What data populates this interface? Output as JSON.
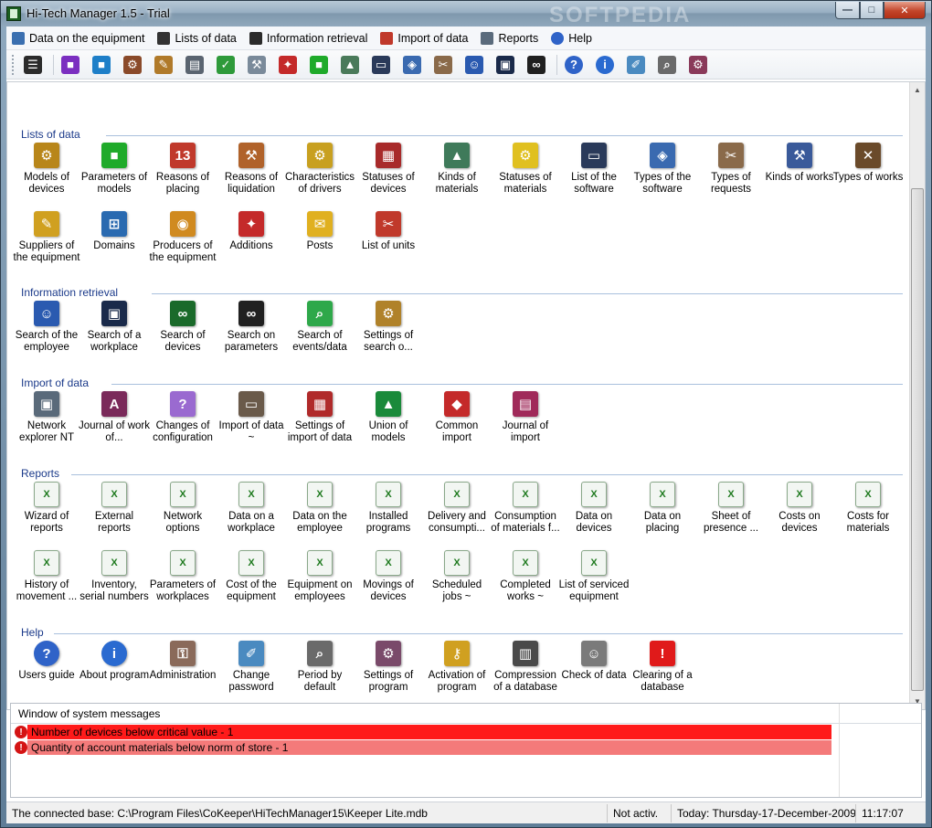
{
  "window": {
    "title": "Hi-Tech Manager 1.5 - Trial",
    "watermark": "SOFTPEDIA",
    "controls": {
      "minimize": "—",
      "maximize": "□",
      "close": "✕"
    }
  },
  "menu": [
    {
      "label": "Data on the equipment",
      "icon": "equipment-icon",
      "color": "#3a6fb0"
    },
    {
      "label": "Lists of data",
      "icon": "tree-list-icon",
      "color": "#333333"
    },
    {
      "label": "Information retrieval",
      "icon": "binoculars-icon",
      "color": "#2b2b2b"
    },
    {
      "label": "Import of data",
      "icon": "import-icon",
      "color": "#c0392b"
    },
    {
      "label": "Reports",
      "icon": "report-icon",
      "color": "#5a6b7c"
    },
    {
      "label": "Help",
      "icon": "help-icon",
      "color": "#2f63c8"
    }
  ],
  "toolbar": [
    {
      "icon": "tree-view-icon",
      "color": "#2b2b2b",
      "glyph": "☰"
    },
    {
      "icon": "purple-cube-icon",
      "color": "#7b2fc0",
      "glyph": "■"
    },
    {
      "icon": "blue-cube-icon",
      "color": "#1e7fc8",
      "glyph": "■"
    },
    {
      "icon": "pinion-icon",
      "color": "#8a4a2a",
      "glyph": "⚙"
    },
    {
      "icon": "edit-icon",
      "color": "#b07a2a",
      "glyph": "✎"
    },
    {
      "icon": "clipboard-icon",
      "color": "#5a6470",
      "glyph": "▤"
    },
    {
      "icon": "check-icon",
      "color": "#2e9a3a",
      "glyph": "✓"
    },
    {
      "icon": "repair-icon",
      "color": "#7a8a9a",
      "glyph": "⚒"
    },
    {
      "icon": "additions-icon",
      "color": "#c42a2a",
      "glyph": "✦"
    },
    {
      "icon": "green-square-icon",
      "color": "#1faa2a",
      "glyph": "■"
    },
    {
      "icon": "material-icon",
      "color": "#4a7a5a",
      "glyph": "▲"
    },
    {
      "icon": "window-icon",
      "color": "#2a3a5a",
      "glyph": "▭"
    },
    {
      "icon": "software-icon",
      "color": "#3a6ab0",
      "glyph": "◈"
    },
    {
      "icon": "tools-icon",
      "color": "#8a6a4a",
      "glyph": "✂"
    },
    {
      "icon": "employee-icon",
      "color": "#2a5ab0",
      "glyph": "☺"
    },
    {
      "icon": "workplace-icon",
      "color": "#1a2a4a",
      "glyph": "▣"
    },
    {
      "icon": "binoculars-icon",
      "color": "#202020",
      "glyph": "∞"
    },
    {
      "icon": "help-icon",
      "color": "#2f63c8",
      "glyph": "?"
    },
    {
      "icon": "info-icon",
      "color": "#2a6ad0",
      "glyph": "i"
    },
    {
      "icon": "change-password-icon",
      "color": "#4a8ac0",
      "glyph": "✐"
    },
    {
      "icon": "period-icon",
      "color": "#6a6a6a",
      "glyph": "⌕"
    },
    {
      "icon": "settings-icon",
      "color": "#8a3a5a",
      "glyph": "⚙"
    }
  ],
  "sections": [
    {
      "title": "Lists of data",
      "items": [
        {
          "label": "Models of devices",
          "icon": "models-of-devices-icon",
          "color": "#b8861a",
          "glyph": "⚙"
        },
        {
          "label": "Parameters of models",
          "icon": "parameters-cube-icon",
          "color": "#1faa2a",
          "glyph": "■"
        },
        {
          "label": "Reasons of placing",
          "icon": "reasons-placing-icon",
          "color": "#c0392b",
          "glyph": "13"
        },
        {
          "label": "Reasons of liquidation",
          "icon": "liquidation-icon",
          "color": "#b0622a",
          "glyph": "⚒"
        },
        {
          "label": "Characteristics of drivers",
          "icon": "drivers-icon",
          "color": "#c8a020",
          "glyph": "⚙"
        },
        {
          "label": "Statuses of devices",
          "icon": "statuses-devices-icon",
          "color": "#a82a2a",
          "glyph": "▦"
        },
        {
          "label": "Kinds of materials",
          "icon": "materials-icon",
          "color": "#3f7a5a",
          "glyph": "▲"
        },
        {
          "label": "Statuses of materials",
          "icon": "folder-gear-icon",
          "color": "#e0c020",
          "glyph": "⚙"
        },
        {
          "label": "List of the software",
          "icon": "software-list-icon",
          "color": "#2a3a5a",
          "glyph": "▭"
        },
        {
          "label": "Types of the software",
          "icon": "software-types-icon",
          "color": "#3a6ab0",
          "glyph": "◈"
        },
        {
          "label": "Types of requests",
          "icon": "requests-icon",
          "color": "#8a6a4a",
          "glyph": "✂"
        },
        {
          "label": "Kinds of works",
          "icon": "works-kinds-icon",
          "color": "#3a5a9a",
          "glyph": "⚒"
        },
        {
          "label": "Types of works",
          "icon": "works-types-icon",
          "color": "#6a4a2a",
          "glyph": "✕"
        },
        {
          "label": "Suppliers of the equipment",
          "icon": "suppliers-icon",
          "color": "#d0a020",
          "glyph": "✎"
        },
        {
          "label": "Domains",
          "icon": "domains-icon",
          "color": "#2a6ab0",
          "glyph": "⊞"
        },
        {
          "label": "Producers of the equipment",
          "icon": "producers-icon",
          "color": "#d08a20",
          "glyph": "◉"
        },
        {
          "label": "Additions",
          "icon": "additions-icon",
          "color": "#c42a2a",
          "glyph": "✦"
        },
        {
          "label": "Posts",
          "icon": "posts-icon",
          "color": "#e0b020",
          "glyph": "✉"
        },
        {
          "label": "List of units",
          "icon": "units-icon",
          "color": "#c0392b",
          "glyph": "✂"
        }
      ]
    },
    {
      "title": "Information retrieval",
      "items": [
        {
          "label": "Search of the employee",
          "icon": "search-employee-icon",
          "color": "#2a5ab0",
          "glyph": "☺"
        },
        {
          "label": "Search of a workplace",
          "icon": "search-workplace-icon",
          "color": "#1a2a4a",
          "glyph": "▣"
        },
        {
          "label": "Search of devices",
          "icon": "search-devices-icon",
          "color": "#1a6a2a",
          "glyph": "∞"
        },
        {
          "label": "Search on parameters",
          "icon": "search-parameters-icon",
          "color": "#202020",
          "glyph": "∞"
        },
        {
          "label": "Search of events/data",
          "icon": "search-events-icon",
          "color": "#2ea84a",
          "glyph": "⌕"
        },
        {
          "label": "Settings of search o...",
          "icon": "search-settings-icon",
          "color": "#b0822a",
          "glyph": "⚙"
        }
      ]
    },
    {
      "title": "Import of data",
      "items": [
        {
          "label": "Network explorer NT",
          "icon": "network-explorer-icon",
          "color": "#5a6a7a",
          "glyph": "▣"
        },
        {
          "label": "Journal of work of...",
          "icon": "journal-work-icon",
          "color": "#7a2a5a",
          "glyph": "A"
        },
        {
          "label": "Changes of configuration",
          "icon": "configuration-icon",
          "color": "#9a6ad0",
          "glyph": "?"
        },
        {
          "label": "Import of data ~",
          "icon": "import-data-icon",
          "color": "#6a5a4a",
          "glyph": "▭"
        },
        {
          "label": "Settings of import of data",
          "icon": "import-settings-icon",
          "color": "#b02a2a",
          "glyph": "▦"
        },
        {
          "label": "Union of models",
          "icon": "union-models-icon",
          "color": "#1a8a3a",
          "glyph": "▲"
        },
        {
          "label": "Common import",
          "icon": "common-import-icon",
          "color": "#c42a2a",
          "glyph": "◆"
        },
        {
          "label": "Journal of import",
          "icon": "journal-import-icon",
          "color": "#a02a5a",
          "glyph": "▤"
        }
      ]
    },
    {
      "title": "Reports",
      "items": [
        {
          "label": "Wizard of reports",
          "icon": "excel-report-icon"
        },
        {
          "label": "External reports",
          "icon": "excel-report-icon"
        },
        {
          "label": "Network options",
          "icon": "excel-report-icon"
        },
        {
          "label": "Data on a workplace",
          "icon": "excel-report-icon"
        },
        {
          "label": "Data on the employee",
          "icon": "excel-report-icon"
        },
        {
          "label": "Installed programs",
          "icon": "excel-report-icon"
        },
        {
          "label": "Delivery and consumpti...",
          "icon": "excel-report-icon"
        },
        {
          "label": "Consumption of materials f...",
          "icon": "excel-report-icon"
        },
        {
          "label": "Data on devices",
          "icon": "excel-report-icon"
        },
        {
          "label": "Data on placing",
          "icon": "excel-report-icon"
        },
        {
          "label": "Sheet of presence ...",
          "icon": "excel-report-icon"
        },
        {
          "label": "Costs on devices",
          "icon": "excel-report-icon"
        },
        {
          "label": "Costs for materials",
          "icon": "excel-report-icon"
        },
        {
          "label": "History of movement ...",
          "icon": "excel-report-icon"
        },
        {
          "label": "Inventory, serial numbers",
          "icon": "excel-report-icon"
        },
        {
          "label": "Parameters of workplaces",
          "icon": "excel-report-icon"
        },
        {
          "label": "Cost of the equipment",
          "icon": "excel-report-icon"
        },
        {
          "label": "Equipment on employees",
          "icon": "excel-report-icon"
        },
        {
          "label": "Movings of devices",
          "icon": "excel-report-icon"
        },
        {
          "label": "Scheduled jobs ~",
          "icon": "excel-report-icon"
        },
        {
          "label": "Completed works ~",
          "icon": "excel-report-icon"
        },
        {
          "label": "List of serviced equipment",
          "icon": "excel-report-icon"
        }
      ]
    },
    {
      "title": "Help",
      "items": [
        {
          "label": "Users guide",
          "icon": "help-icon",
          "color": "#2f63c8",
          "glyph": "?"
        },
        {
          "label": "About program",
          "icon": "info-icon",
          "color": "#2a6ad0",
          "glyph": "i"
        },
        {
          "label": "Administration",
          "icon": "administration-icon",
          "color": "#8a6a5a",
          "glyph": "⚿"
        },
        {
          "label": "Change password",
          "icon": "change-password-icon",
          "color": "#4a8ac0",
          "glyph": "✐"
        },
        {
          "label": "Period by default",
          "icon": "period-icon",
          "color": "#6a6a6a",
          "glyph": "⌕"
        },
        {
          "label": "Settings of program",
          "icon": "program-settings-icon",
          "color": "#7a4a6a",
          "glyph": "⚙"
        },
        {
          "label": "Activation of program",
          "icon": "activation-key-icon",
          "color": "#d0a020",
          "glyph": "⚷"
        },
        {
          "label": "Compression of a database",
          "icon": "compression-icon",
          "color": "#4a4a4a",
          "glyph": "▥"
        },
        {
          "label": "Check of data",
          "icon": "check-data-icon",
          "color": "#7a7a7a",
          "glyph": "☺"
        },
        {
          "label": "Clearing of a database",
          "icon": "clearing-db-icon",
          "color": "#e01a1a",
          "glyph": "!"
        }
      ]
    }
  ],
  "messages": {
    "title": "Window of system messages",
    "items": [
      {
        "text": "Number of devices below critical value - 1",
        "level": "critical",
        "color": "#ff1a1a"
      },
      {
        "text": "Quantity of account materials below norm of store - 1",
        "level": "warning",
        "color": "#f47a7a"
      }
    ]
  },
  "status": {
    "connected": "The connected base: C:\\Program Files\\CoKeeper\\HiTechManager15\\Keeper Lite.mdb",
    "activation": "Not activ.",
    "date": "Today: Thursday-17-December-2009",
    "time": "11:17:07"
  }
}
